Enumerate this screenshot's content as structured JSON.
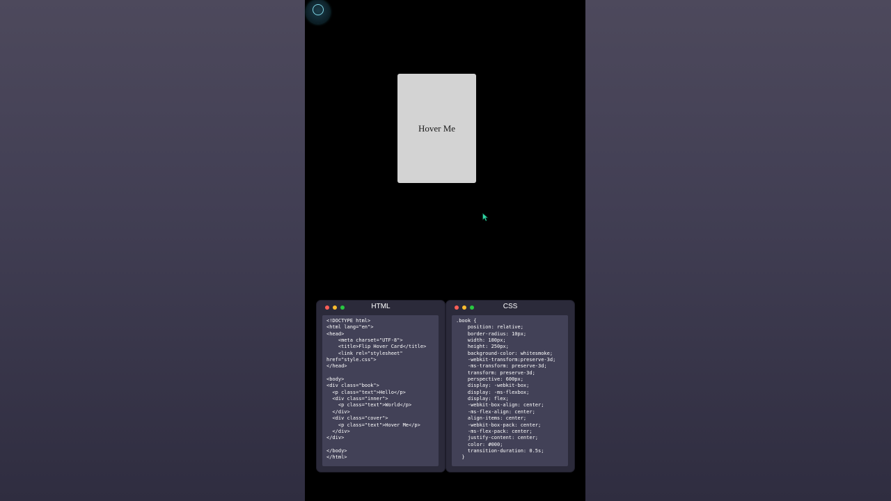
{
  "colors": {
    "background": "#3e3b4f",
    "phone_bg": "#000000",
    "card_bg": "#d3d3d3",
    "panel_bg": "#2b2a3a",
    "code_bg": "#424157",
    "dot_red": "#ff5f57",
    "dot_yellow": "#febc2e",
    "dot_green": "#28c840",
    "cursor": "#2fd6a3"
  },
  "logo": {
    "icon": "logo-icon",
    "caption": ""
  },
  "card": {
    "label": "Hover Me"
  },
  "panels": {
    "html": {
      "title": "HTML",
      "code": "<!DOCTYPE html>\n<html lang=\"en\">\n<head>\n    <meta charset=\"UTF-8\">\n    <title>Flip Hover Card</title>\n    <link rel=\"stylesheet\"\nhref=\"style.css\">\n</head>\n\n<body>\n<div class=\"book\">\n  <p class=\"text\">Hello</p>\n  <div class=\"inner\">\n    <p class=\"text\">World</p>\n  </div>\n  <div class=\"cover\">\n    <p class=\"text\">Hover Me</p>\n  </div>\n</div>\n\n</body>\n</html>"
    },
    "css": {
      "title": "CSS",
      "code": ".book {\n    position: relative;\n    border-radius: 10px;\n    width: 180px;\n    height: 250px;\n    background-color: whitesmoke;\n    -webkit-transform:preserve-3d;\n    -ms-transform: preserve-3d;\n    transform: preserve-3d;\n    perspective: 600px;\n    display: -webkit-box;\n    display: -ms-flexbox;\n    display: flex;\n    -webkit-box-align: center;\n    -ms-flex-align: center;\n    align-items: center;\n    -webkit-box-pack: center;\n    -ms-flex-pack: center;\n    justify-content: center;\n    color: #000;\n    transition-duration: 0.5s;\n  }"
    }
  }
}
